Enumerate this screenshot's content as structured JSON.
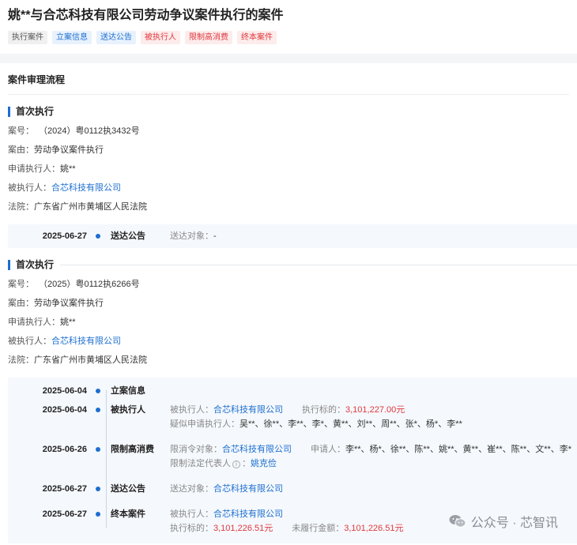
{
  "page": {
    "title": "姚**与合芯科技有限公司劳动争议案件执行的案件",
    "tags": [
      {
        "label": "执行案件",
        "style": "gray"
      },
      {
        "label": "立案信息",
        "style": "blue"
      },
      {
        "label": "送达公告",
        "style": "blue"
      },
      {
        "label": "被执行人",
        "style": "red"
      },
      {
        "label": "限制高消费",
        "style": "red"
      },
      {
        "label": "终本案件",
        "style": "red"
      }
    ]
  },
  "section": {
    "title": "案件审理流程"
  },
  "labels": {
    "case_no": "案号：",
    "cause": "案由：",
    "applicant": "申请执行人：",
    "respondent": "被执行人：",
    "court": "法院："
  },
  "cases": [
    {
      "title": "首次执行",
      "case_no": "（2024）粤0112执3432号",
      "cause": "劳动争议案件执行",
      "applicant": "姚**",
      "respondent": "合芯科技有限公司",
      "court": "广东省广州市黄埔区人民法院",
      "events": [
        {
          "date": "2025-06-27",
          "type": "送达公告",
          "k1": "送达对象：",
          "v1": "-"
        }
      ]
    },
    {
      "title": "首次执行",
      "case_no": "（2025）粤0112执6266号",
      "cause": "劳动争议案件执行",
      "applicant": "姚**",
      "respondent": "合芯科技有限公司",
      "court": "广东省广州市黄埔区人民法院",
      "events": [
        {
          "date": "2025-06-04",
          "type": "立案信息"
        },
        {
          "date": "2025-06-04",
          "type": "被执行人",
          "k1": "被执行人：",
          "v1": "合芯科技有限公司",
          "k2": "执行标的：",
          "v2": "3,101,227.00元",
          "k3": "疑似申请执行人：",
          "v3": "吴**、徐**、李**、李*、黄**、刘**、周**、张*、杨*、李**"
        },
        {
          "date": "2025-06-26",
          "type": "限制高消费",
          "k1": "限消令对象：",
          "v1": "合芯科技有限公司",
          "k2": "申请人：",
          "v2": "李**、杨*、徐**、陈**、姚**、黄**、崔**、陈**、文**、李*",
          "k3": "限制法定代表人",
          "v3": "姚克俭"
        },
        {
          "date": "2025-06-27",
          "type": "送达公告",
          "k1": "送达对象：",
          "v1": "合芯科技有限公司"
        },
        {
          "date": "2025-06-27",
          "type": "终本案件",
          "k1": "被执行人：",
          "v1": "合芯科技有限公司",
          "k2": "执行标的：",
          "v2": "3,101,226.51元",
          "k3": "未履行金额：",
          "v3": "3,101,226.51元"
        }
      ]
    }
  ],
  "watermark": {
    "text": "公众号 · 芯智讯",
    "icon": "wechat-icon"
  },
  "colors": {
    "accent": "#1d6fd0",
    "danger": "#e0393e"
  }
}
